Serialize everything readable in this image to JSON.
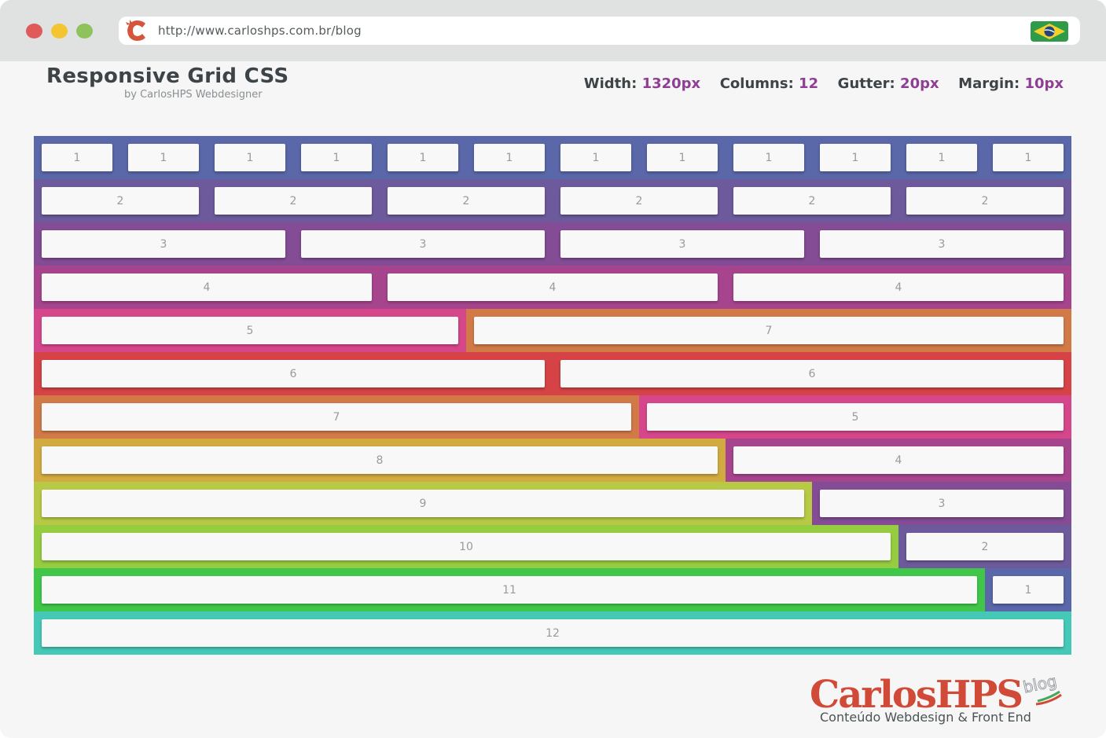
{
  "browser": {
    "url": "http://www.carloshps.com.br/blog",
    "traffic_lights": [
      "#e05a5a",
      "#f4c530",
      "#8dc35a"
    ],
    "flag_icon": "brazil-flag-icon",
    "site_icon": "carloshps-c-logo-icon"
  },
  "header": {
    "title": "Responsive Grid CSS",
    "subtitle": "by CarlosHPS Webdesigner",
    "specs": [
      {
        "label": "Width:",
        "value": "1320px"
      },
      {
        "label": "Columns:",
        "value": "12"
      },
      {
        "label": "Gutter:",
        "value": "20px"
      },
      {
        "label": "Margin:",
        "value": "10px"
      }
    ]
  },
  "colors": {
    "span_1": "#5a67a8",
    "span_2": "#6d5a9c",
    "span_3": "#834c94",
    "span_4": "#a7448e",
    "span_5": "#d5478a",
    "span_6": "#d54346",
    "span_7": "#d17a48",
    "span_8": "#d1ab40",
    "span_9": "#b7c945",
    "span_10": "#96cc3f",
    "span_11": "#40c74a",
    "span_12": "#46c8b7",
    "accent": "#8e3f94",
    "text_dark": "#3d4448"
  },
  "grid": {
    "columns": 12,
    "rows": [
      {
        "spans": [
          1,
          1,
          1,
          1,
          1,
          1,
          1,
          1,
          1,
          1,
          1,
          1
        ],
        "labels": [
          "1",
          "1",
          "1",
          "1",
          "1",
          "1",
          "1",
          "1",
          "1",
          "1",
          "1",
          "1"
        ]
      },
      {
        "spans": [
          2,
          2,
          2,
          2,
          2,
          2
        ],
        "labels": [
          "2",
          "2",
          "2",
          "2",
          "2",
          "2"
        ]
      },
      {
        "spans": [
          3,
          3,
          3,
          3
        ],
        "labels": [
          "3",
          "3",
          "3",
          "3"
        ]
      },
      {
        "spans": [
          4,
          4,
          4
        ],
        "labels": [
          "4",
          "4",
          "4"
        ]
      },
      {
        "spans": [
          5,
          7
        ],
        "labels": [
          "5",
          "7"
        ]
      },
      {
        "spans": [
          6,
          6
        ],
        "labels": [
          "6",
          "6"
        ]
      },
      {
        "spans": [
          7,
          5
        ],
        "labels": [
          "7",
          "5"
        ]
      },
      {
        "spans": [
          8,
          4
        ],
        "labels": [
          "8",
          "4"
        ]
      },
      {
        "spans": [
          9,
          3
        ],
        "labels": [
          "9",
          "3"
        ]
      },
      {
        "spans": [
          10,
          2
        ],
        "labels": [
          "10",
          "2"
        ]
      },
      {
        "spans": [
          11,
          1
        ],
        "labels": [
          "11",
          "1"
        ]
      },
      {
        "spans": [
          12
        ],
        "labels": [
          "12"
        ]
      }
    ]
  },
  "brand": {
    "logo_text": "CarlosHPS",
    "logo_suffix": "blog",
    "tagline": "Conteúdo Webdesign & Front End"
  }
}
